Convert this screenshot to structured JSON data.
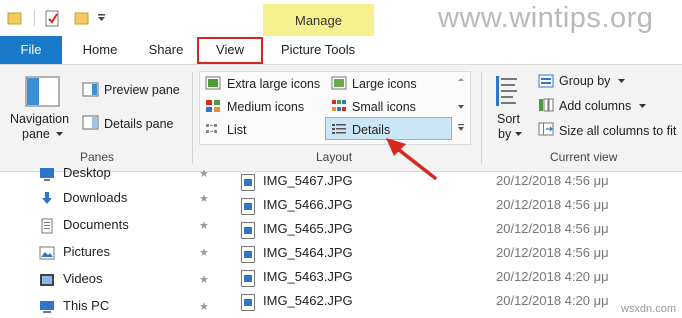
{
  "watermark": "www.wintips.org",
  "credit": "wsxdn.com",
  "manage_label": "Manage",
  "tabs": {
    "file": "File",
    "home": "Home",
    "share": "Share",
    "view": "View",
    "picture_tools": "Picture Tools"
  },
  "ribbon": {
    "panes": {
      "label": "Panes",
      "navigation_pane": "Navigation",
      "navigation_pane_2": "pane",
      "preview_pane": "Preview pane",
      "details_pane": "Details pane"
    },
    "layout": {
      "label": "Layout",
      "extra_large_icons": "Extra large icons",
      "large_icons": "Large icons",
      "medium_icons": "Medium icons",
      "small_icons": "Small icons",
      "list": "List",
      "details": "Details"
    },
    "current_view": {
      "label": "Current view",
      "sort_by": "Sort",
      "sort_by_2": "by",
      "group_by": "Group by",
      "add_columns": "Add columns",
      "size_all_columns": "Size all columns to fit"
    }
  },
  "nav_items": [
    {
      "label": "Desktop",
      "icon": "desktop-icon"
    },
    {
      "label": "Downloads",
      "icon": "downloads-icon"
    },
    {
      "label": "Documents",
      "icon": "documents-icon"
    },
    {
      "label": "Pictures",
      "icon": "pictures-icon"
    },
    {
      "label": "Videos",
      "icon": "videos-icon"
    },
    {
      "label": "This PC",
      "icon": "this-pc-icon"
    }
  ],
  "files": [
    {
      "name": "IMG_5467.JPG",
      "date": "20/12/2018 4:56 μμ"
    },
    {
      "name": "IMG_5466.JPG",
      "date": "20/12/2018 4:56 μμ"
    },
    {
      "name": "IMG_5465.JPG",
      "date": "20/12/2018 4:56 μμ"
    },
    {
      "name": "IMG_5464.JPG",
      "date": "20/12/2018 4:56 μμ"
    },
    {
      "name": "IMG_5463.JPG",
      "date": "20/12/2018 4:20 μμ"
    },
    {
      "name": "IMG_5462.JPG",
      "date": "20/12/2018 4:20 μμ"
    }
  ],
  "colors": {
    "file_tab": "#1979ca",
    "manage_band": "#f6f08e",
    "highlight_box": "#d7281e",
    "selection": "#cde6f7",
    "arrow": "#d7281e"
  }
}
